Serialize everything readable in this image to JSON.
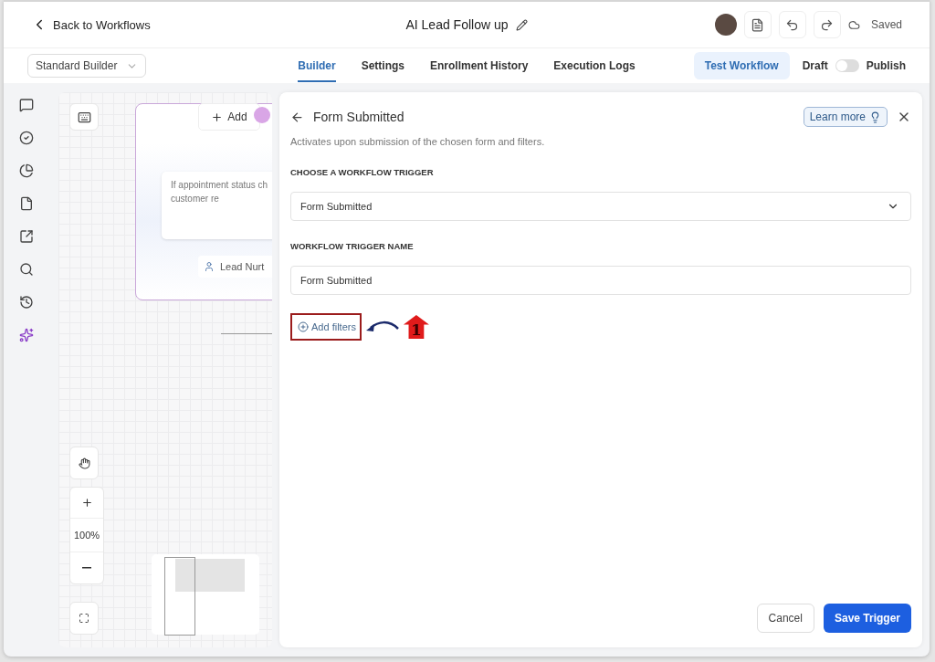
{
  "header": {
    "back": "Back to Workflows",
    "title": "AI Lead Follow up",
    "saved": "Saved"
  },
  "builder_select": {
    "value": "Standard Builder"
  },
  "tabs": [
    {
      "label": "Builder",
      "selected": true
    },
    {
      "label": "Settings",
      "selected": false
    },
    {
      "label": "Enrollment History",
      "selected": false
    },
    {
      "label": "Execution Logs",
      "selected": false
    }
  ],
  "test_button": "Test Workflow",
  "publish": {
    "off_label": "Draft",
    "on_label": "Publish",
    "on": false
  },
  "rail": [
    {
      "kind": "chat"
    },
    {
      "kind": "check"
    },
    {
      "kind": "pie"
    },
    {
      "kind": "file"
    },
    {
      "kind": "external"
    },
    {
      "kind": "search"
    },
    {
      "kind": "history"
    },
    {
      "kind": "sparkle"
    }
  ],
  "canvas": {
    "add": "Add",
    "note_lines": [
      "If appointment status ch",
      "customer re"
    ],
    "tag": "Lead Nurt",
    "zoom": "100%"
  },
  "panel": {
    "title": "Form Submitted",
    "learn_more": "Learn more",
    "description": "Activates upon submission of the chosen form and filters.",
    "trigger_label": "CHOOSE A WORKFLOW TRIGGER",
    "trigger_value": "Form Submitted",
    "name_label": "WORKFLOW TRIGGER NAME",
    "name_value": "Form Submitted",
    "add_filters": "Add filters",
    "callout": "1",
    "cancel": "Cancel",
    "save": "Save Trigger"
  }
}
